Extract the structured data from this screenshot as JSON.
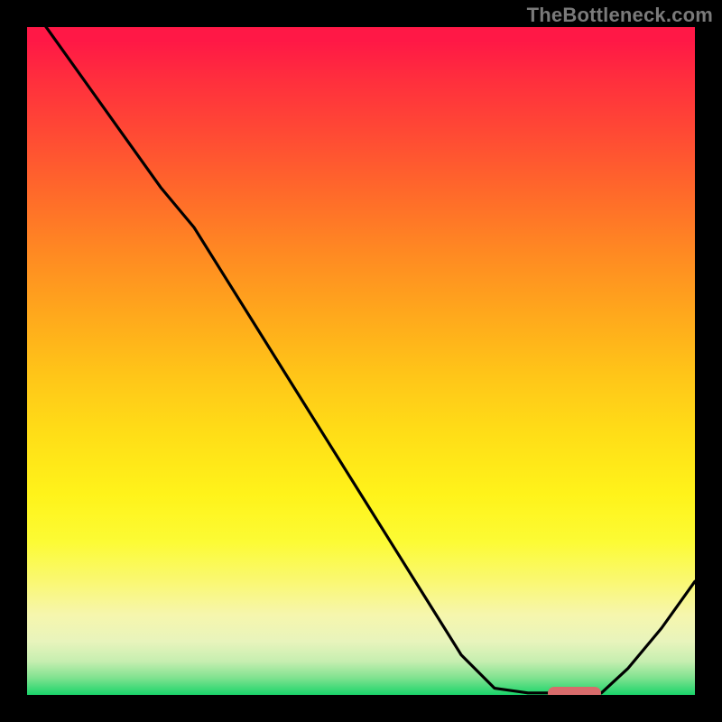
{
  "attribution": "TheBottleneck.com",
  "colors": {
    "frame": "#000000",
    "marker": "#d86b6b",
    "curve": "#000000"
  },
  "chart_data": {
    "type": "line",
    "title": "",
    "xlabel": "",
    "ylabel": "",
    "x": [
      0.0,
      0.05,
      0.1,
      0.15,
      0.2,
      0.25,
      0.3,
      0.35,
      0.4,
      0.45,
      0.5,
      0.55,
      0.6,
      0.65,
      0.7,
      0.75,
      0.78,
      0.8,
      0.83,
      0.86,
      0.9,
      0.95,
      1.0
    ],
    "values": [
      1.04,
      0.97,
      0.9,
      0.83,
      0.76,
      0.7,
      0.62,
      0.54,
      0.46,
      0.38,
      0.3,
      0.22,
      0.14,
      0.06,
      0.01,
      0.003,
      0.003,
      0.003,
      0.003,
      0.003,
      0.04,
      0.1,
      0.17
    ],
    "xlim": [
      0,
      1
    ],
    "ylim": [
      0,
      1
    ],
    "background": "gradient-red-to-green-vertical",
    "marker_segment": {
      "x0": 0.78,
      "x1": 0.86,
      "y": 0.003
    }
  }
}
